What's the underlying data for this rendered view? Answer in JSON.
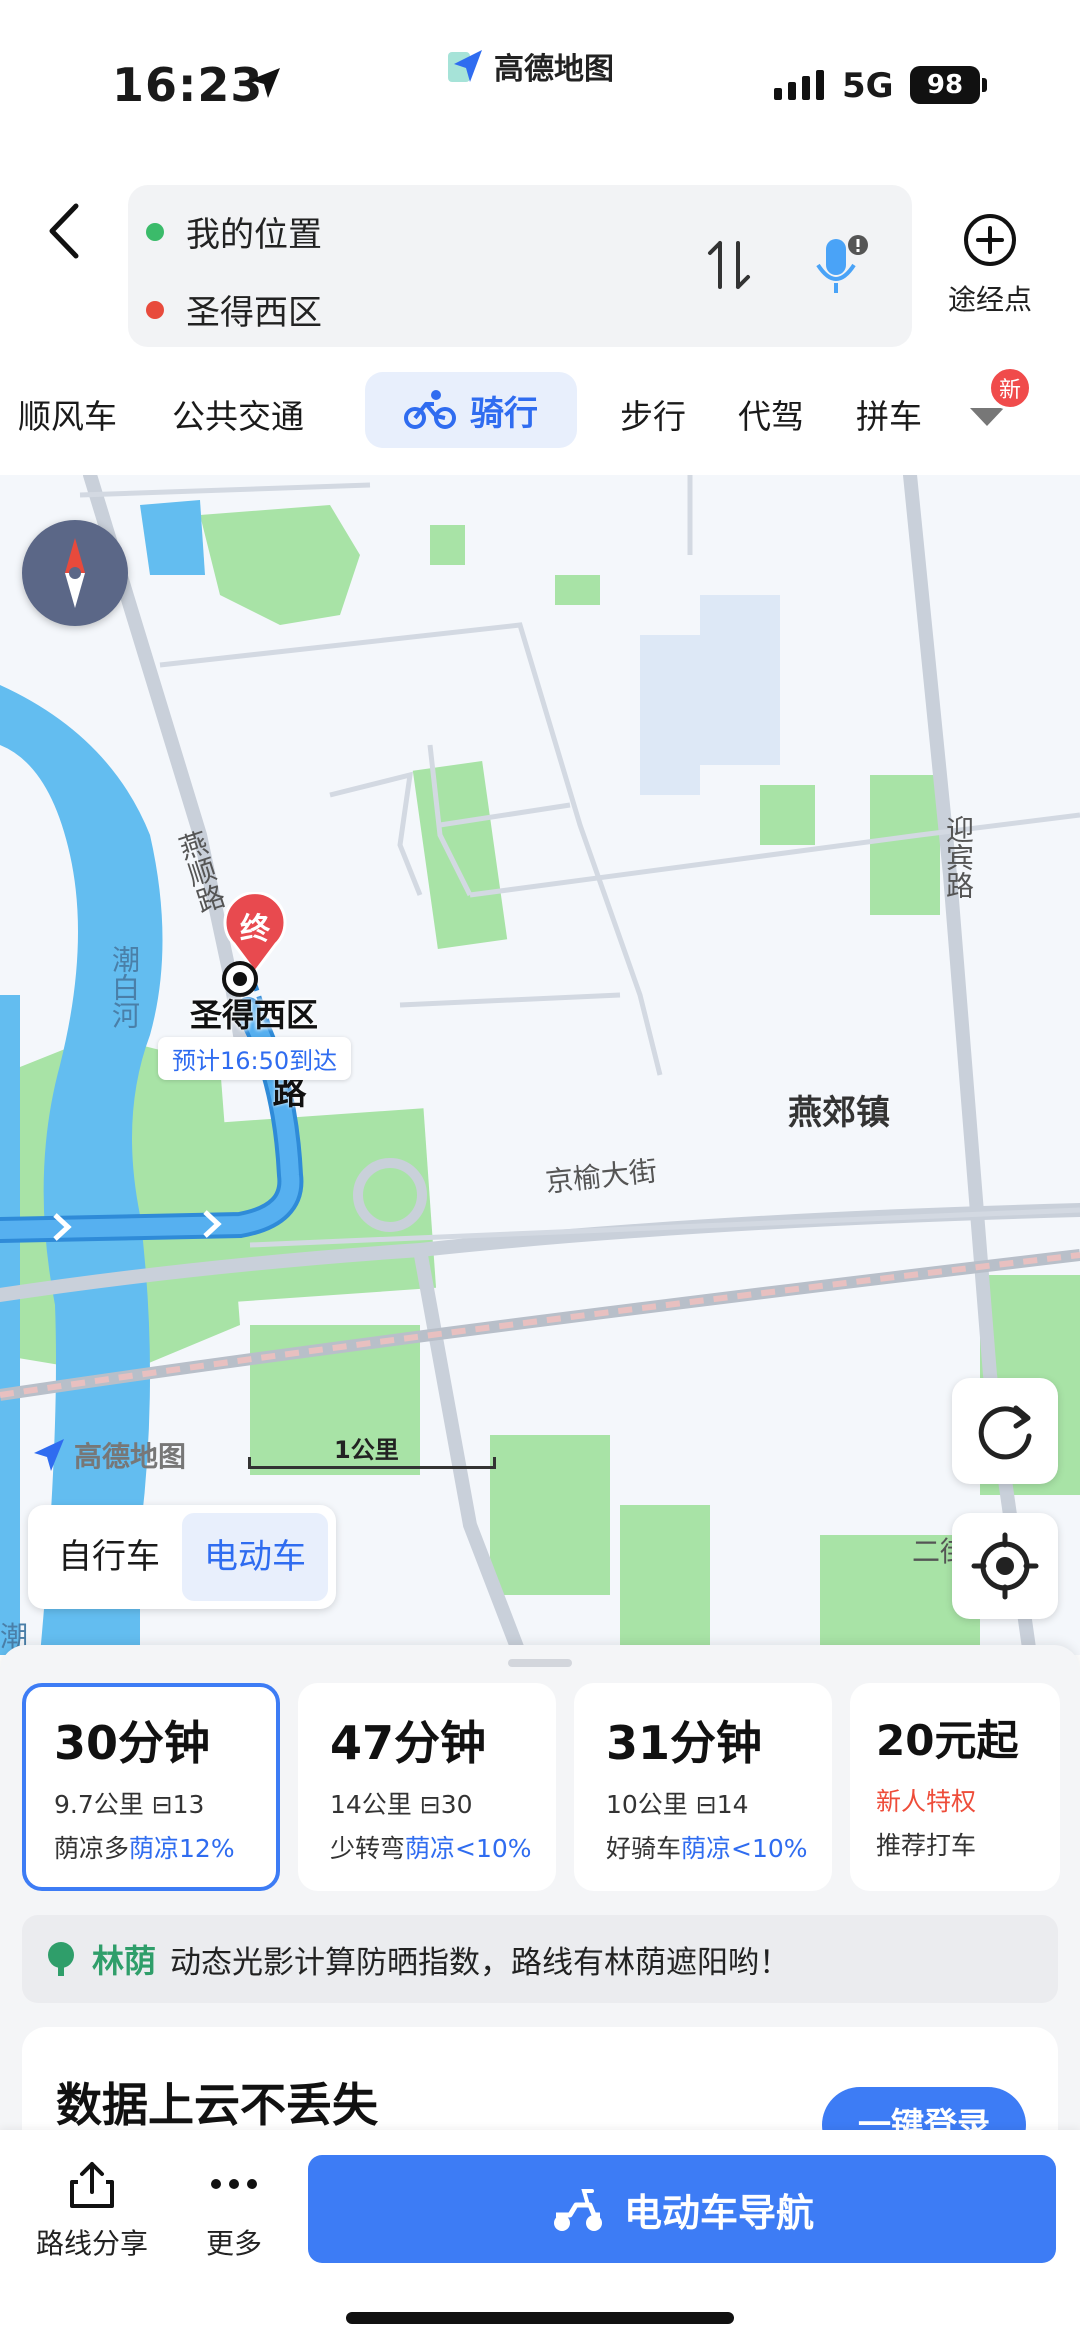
{
  "status_bar": {
    "time": "16:23",
    "app_name": "高德地图",
    "network": "5G",
    "battery": "98"
  },
  "route": {
    "origin": "我的位置",
    "destination": "圣得西区",
    "waypoint_label": "途经点"
  },
  "modes": [
    {
      "label": "顺风车"
    },
    {
      "label": "公共交通"
    },
    {
      "label": "骑行"
    },
    {
      "label": "步行"
    },
    {
      "label": "代驾"
    },
    {
      "label": "拼车"
    }
  ],
  "new_badge": "新",
  "map": {
    "roads": {
      "yanshun": "燕顺路",
      "yingbin": "迎宾路",
      "jingyu": "京榆大街",
      "chaobai": "潮白河",
      "road_shun_lu": "顺路",
      "road_er": "二街",
      "bottom_left": "潮"
    },
    "town": "燕郊镇",
    "destination_marker": "终",
    "destination_name": "圣得西区",
    "eta": "预计16:50到达",
    "logo": "高德地图",
    "scale": "1公里"
  },
  "vehicle_toggle": {
    "bike": "自行车",
    "ebike": "电动车"
  },
  "route_cards": [
    {
      "time": "30分钟",
      "meta": "9.7公里 ⊟13",
      "tag": "荫凉多",
      "tag_hl": "荫凉12%",
      "selected": true
    },
    {
      "time": "47分钟",
      "meta": "14公里 ⊟30",
      "tag": "少转弯",
      "tag_hl": "荫凉<10%"
    },
    {
      "time": "31分钟",
      "meta": "10公里 ⊟14",
      "tag": "好骑车",
      "tag_hl": "荫凉<10%"
    },
    {
      "time": "20元起",
      "meta": "新人特权",
      "tag": "推荐打车"
    }
  ],
  "shade_banner": {
    "title": "林荫",
    "desc": "动态光影计算防晒指数，路线有林荫遮阳哟！"
  },
  "cloud_card": {
    "title": "数据上云不丢失",
    "login": "一键登录"
  },
  "bottom_bar": {
    "share": "路线分享",
    "more": "更多",
    "nav": "电动车导航"
  },
  "colors": {
    "accent": "#3d7cf5",
    "green": "#2f9e6a",
    "route_blue": "#56b0f0"
  }
}
